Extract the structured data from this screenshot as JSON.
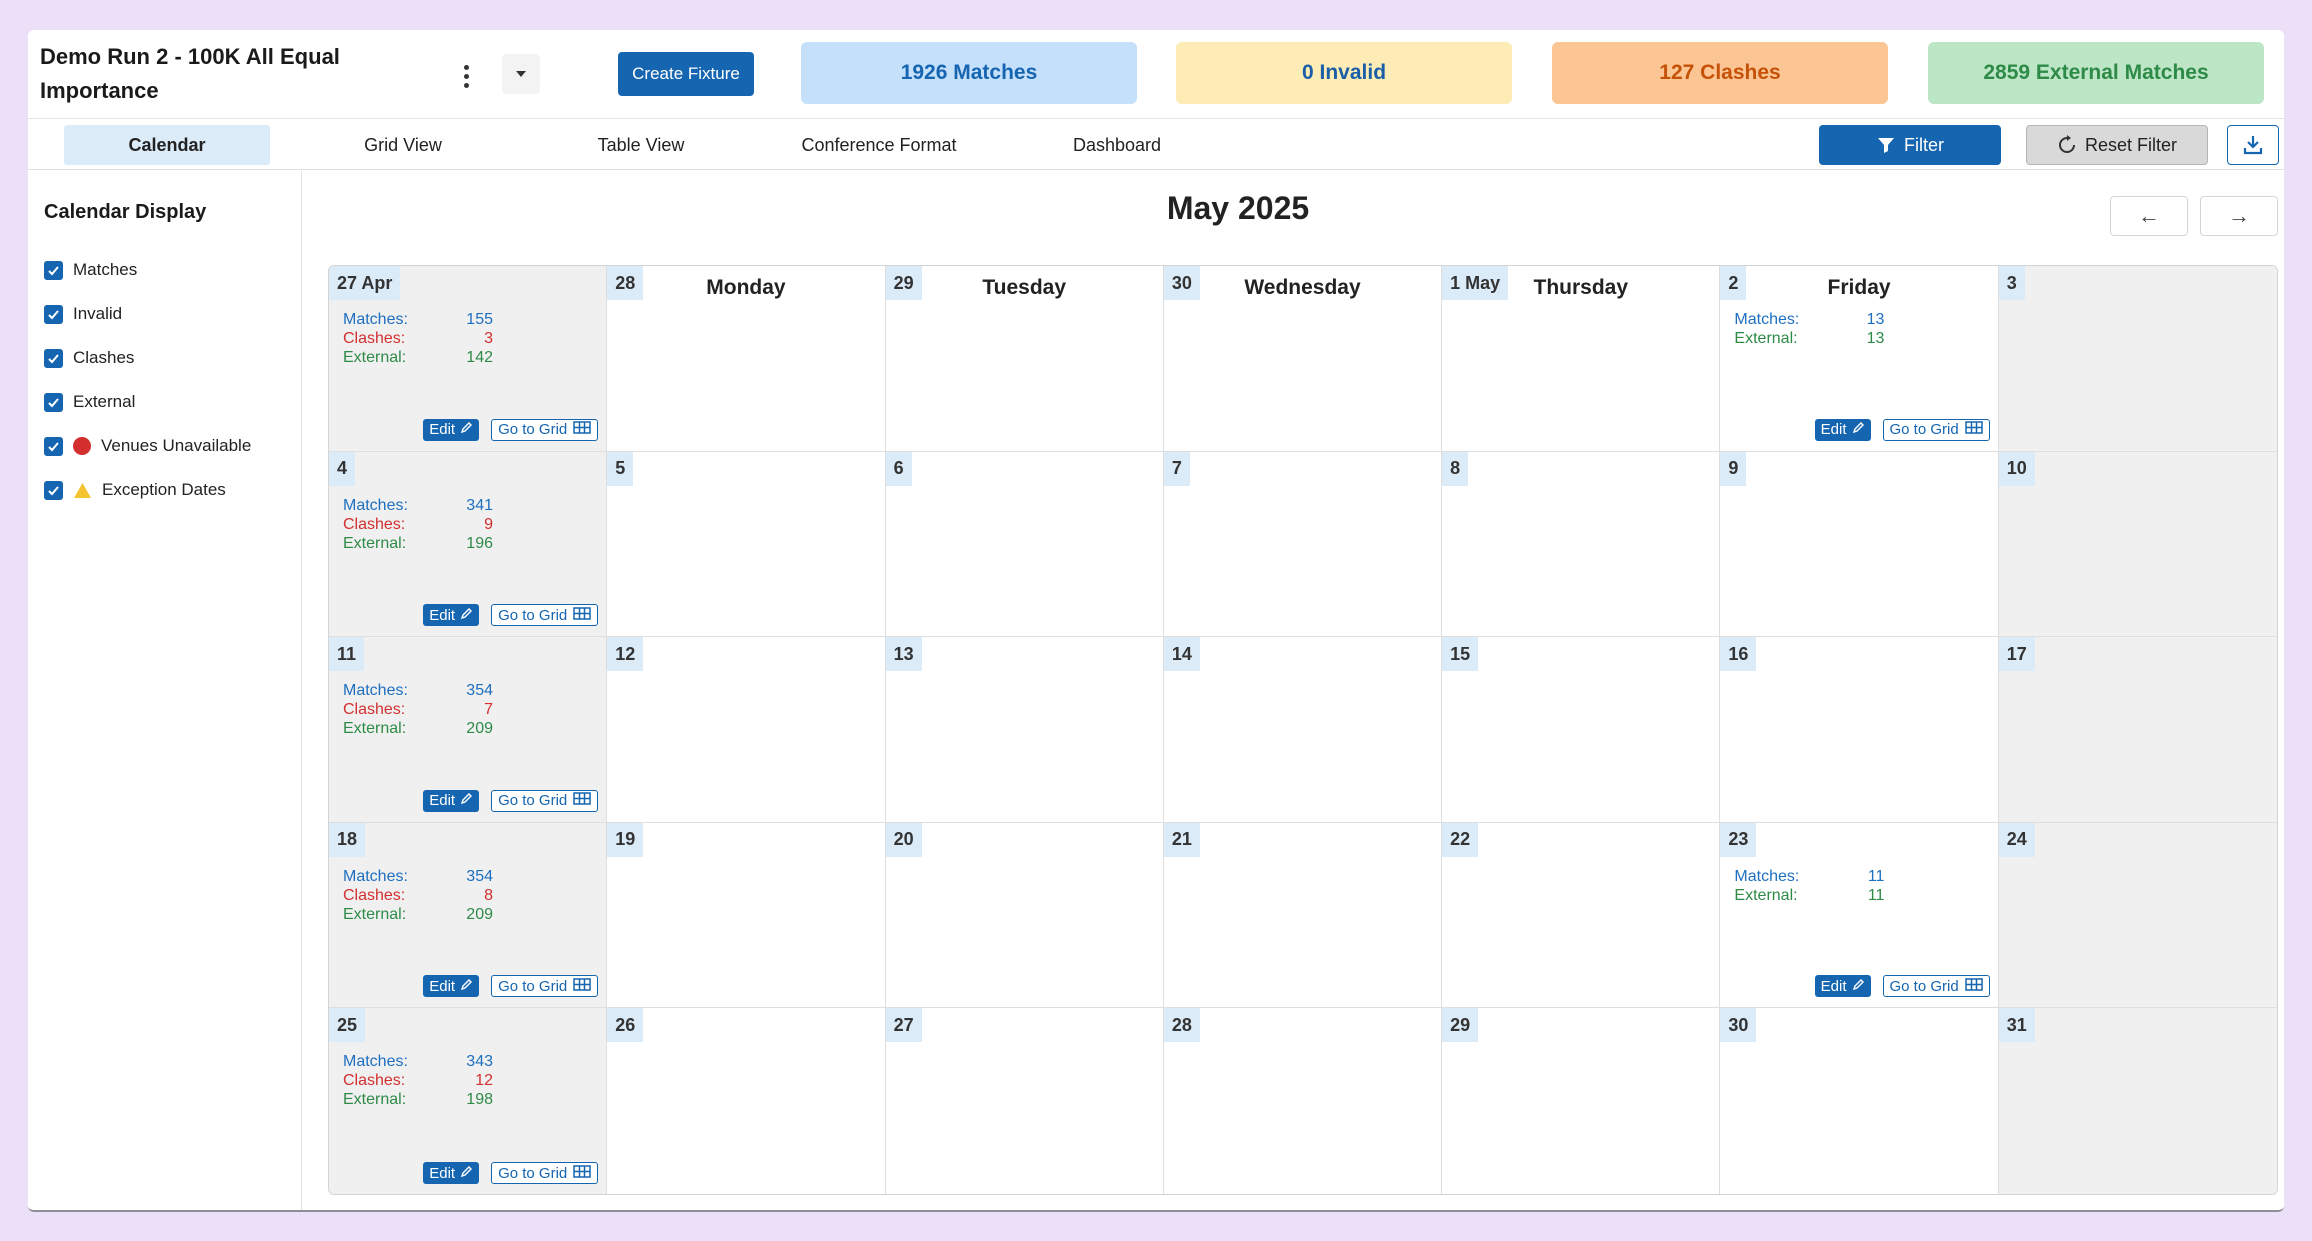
{
  "header": {
    "title": "Demo Run 2 - 100K All Equal Importance",
    "create_label": "Create Fixture",
    "stats": {
      "matches": "1926 Matches",
      "invalid": "0 Invalid",
      "clashes": "127 Clashes",
      "external": "2859 External Matches"
    }
  },
  "tabs": [
    "Calendar",
    "Grid View",
    "Table View",
    "Conference Format",
    "Dashboard"
  ],
  "toolbar": {
    "filter_label": "Filter",
    "reset_label": "Reset Filter"
  },
  "sidebar": {
    "title": "Calendar Display",
    "items": [
      "Matches",
      "Invalid",
      "Clashes",
      "External",
      "Venues Unavailable",
      "Exception Dates"
    ]
  },
  "calendar": {
    "month_title": "May 2025",
    "prev_arrow": "←",
    "next_arrow": "→",
    "weekdays": {
      "1": "Monday",
      "2": "Tuesday",
      "3": "Wednesday",
      "4": "Thursday",
      "5": "Friday"
    },
    "stat_labels": {
      "matches": "Matches:",
      "clashes": "Clashes:",
      "external": "External:"
    },
    "edit_label": "Edit",
    "grid_label": "Go to Grid",
    "days": [
      {
        "label": "27 Apr",
        "matches": "155",
        "clashes": "3",
        "external": "142"
      },
      {
        "label": "28"
      },
      {
        "label": "29"
      },
      {
        "label": "30"
      },
      {
        "label": "1 May"
      },
      {
        "label": "2",
        "matches": "13",
        "external": "13"
      },
      {
        "label": "3"
      },
      {
        "label": "4",
        "matches": "341",
        "clashes": "9",
        "external": "196"
      },
      {
        "label": "5"
      },
      {
        "label": "6"
      },
      {
        "label": "7"
      },
      {
        "label": "8"
      },
      {
        "label": "9"
      },
      {
        "label": "10"
      },
      {
        "label": "11",
        "matches": "354",
        "clashes": "7",
        "external": "209"
      },
      {
        "label": "12"
      },
      {
        "label": "13"
      },
      {
        "label": "14"
      },
      {
        "label": "15"
      },
      {
        "label": "16"
      },
      {
        "label": "17"
      },
      {
        "label": "18",
        "matches": "354",
        "clashes": "8",
        "external": "209"
      },
      {
        "label": "19"
      },
      {
        "label": "20"
      },
      {
        "label": "21"
      },
      {
        "label": "22"
      },
      {
        "label": "23",
        "matches": "11",
        "external": "11"
      },
      {
        "label": "24"
      },
      {
        "label": "25",
        "matches": "343",
        "clashes": "12",
        "external": "198"
      },
      {
        "label": "26"
      },
      {
        "label": "27"
      },
      {
        "label": "28"
      },
      {
        "label": "29"
      },
      {
        "label": "30"
      },
      {
        "label": "31"
      }
    ]
  }
}
